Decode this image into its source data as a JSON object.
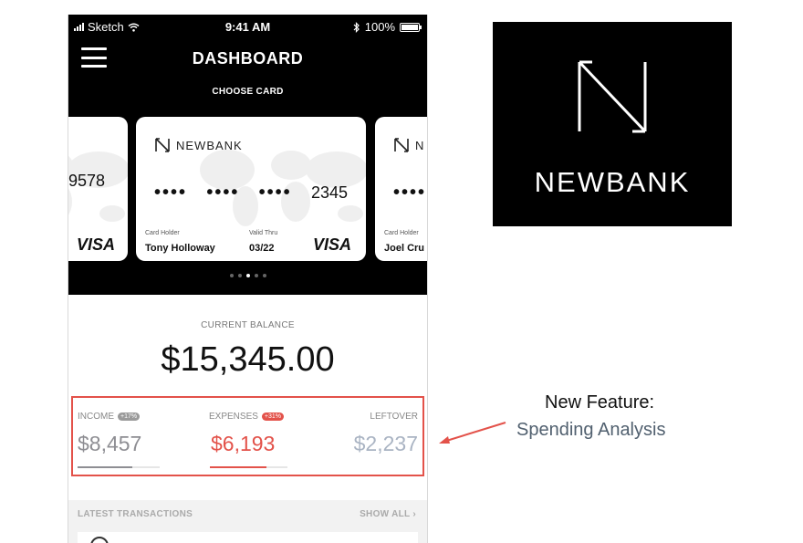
{
  "status_bar": {
    "carrier": "Sketch",
    "time": "9:41 AM",
    "battery": "100%"
  },
  "header": {
    "title": "DASHBOARD",
    "subtitle": "CHOOSE CARD"
  },
  "cards": {
    "left": {
      "number_tail": "9578",
      "network": "VISA"
    },
    "center": {
      "brand": "NEWBANK",
      "dots1": "••••",
      "dots2": "••••",
      "dots3": "••••",
      "last4": "2345",
      "holder_label": "Card Holder",
      "holder": "Tony Holloway",
      "valid_label": "Valid Thru",
      "valid": "03/22",
      "network": "VISA"
    },
    "right": {
      "brand": "N",
      "dots": "••••",
      "holder_label": "Card Holder",
      "holder": "Joel Cru"
    }
  },
  "pager": {
    "count": 5,
    "active_index": 2
  },
  "balance": {
    "label": "CURRENT BALANCE",
    "value": "$15,345.00"
  },
  "stats": [
    {
      "label": "INCOME",
      "badge": "+17%",
      "value": "$8,457",
      "color": "#8e8e93",
      "badge_color": "#9a9a9a",
      "fill": 0.67
    },
    {
      "label": "EXPENSES",
      "badge": "+31%",
      "value": "$6,193",
      "color": "#e3524a",
      "badge_color": "#e3524a",
      "fill": 0.73
    },
    {
      "label": "LEFTOVER",
      "value": "$2,237",
      "color": "#aab4c3"
    }
  ],
  "transactions": {
    "title": "LATEST TRANSACTIONS",
    "show_all": "SHOW ALL"
  },
  "logo": {
    "wordmark": "NEWBANK"
  },
  "callout": {
    "line1": "New Feature:",
    "line2": "Spending Analysis"
  },
  "colors": {
    "accent_red": "#e3524a",
    "callout_blue": "#51606f"
  }
}
